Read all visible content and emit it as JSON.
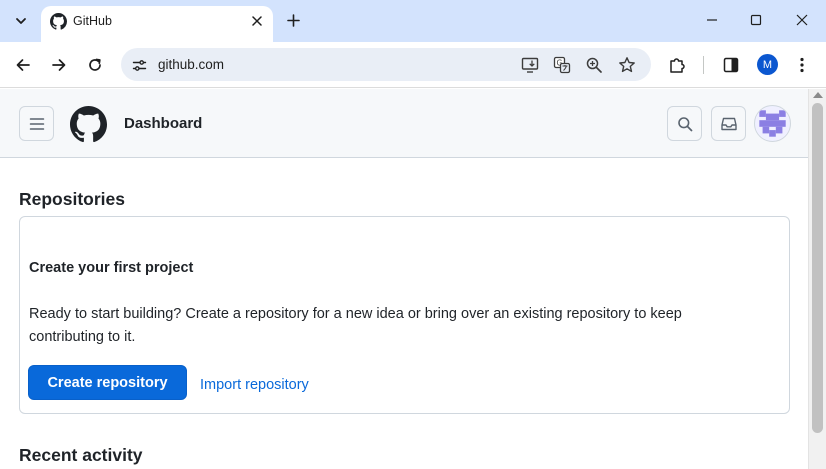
{
  "browser": {
    "tab_title": "GitHub",
    "url": "github.com",
    "profile_initial": "M"
  },
  "github": {
    "header_title": "Dashboard",
    "repositories_heading": "Repositories",
    "card": {
      "title": "Create your first project",
      "text": "Ready to start building? Create a repository for a new idea or bring over an existing repository to keep contributing to it.",
      "primary_button": "Create repository",
      "secondary_link": "Import repository"
    },
    "recent_activity_heading": "Recent activity"
  },
  "colors": {
    "tabstrip": "#d3e3fd",
    "primary_button": "#0969da",
    "link": "#0969da",
    "header_bg": "#f6f8fa"
  }
}
